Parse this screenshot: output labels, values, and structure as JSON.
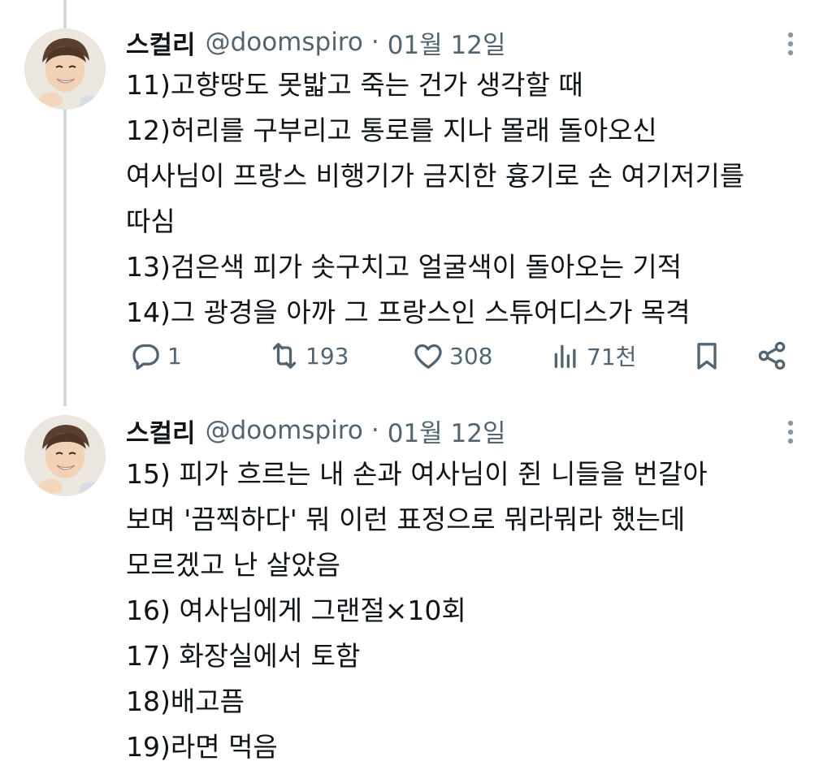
{
  "tweets": [
    {
      "display_name": "스컬리",
      "handle": "@doomspiro",
      "separator": "·",
      "date": "01월 12일",
      "avatar_icon": "profile-photo",
      "lines": [
        "11)고향땅도 못밟고 죽는 건가 생각할 때",
        "12)허리를 구부리고 통로를 지나 몰래 돌아오신",
        "여사님이 프랑스 비행기가 금지한 흉기로 손 여기저기를",
        "따심",
        "13)검은색 피가 솟구치고 얼굴색이 돌아오는 기적",
        "14)그 광경을 아까 그 프랑스인 스튜어디스가 목격"
      ],
      "actions": {
        "replies": "1",
        "retweets": "193",
        "likes": "308",
        "views": "71천"
      }
    },
    {
      "display_name": "스컬리",
      "handle": "@doomspiro",
      "separator": "·",
      "date": "01월 12일",
      "avatar_icon": "profile-photo",
      "lines": [
        "15) 피가 흐르는 내 손과 여사님이 쥔 니들을 번갈아",
        "보며 '끔찍하다' 뭐 이런 표정으로 뭐라뭐라 했는데",
        "모르겠고 난 살았음",
        "16) 여사님에게 그랜절×10회",
        "17) 화장실에서 토함",
        "18)배고픔",
        "19)라면 먹음"
      ]
    }
  ],
  "colors": {
    "text_primary": "#0f1419",
    "text_secondary": "#536471",
    "thread_line": "#cfd9de"
  }
}
